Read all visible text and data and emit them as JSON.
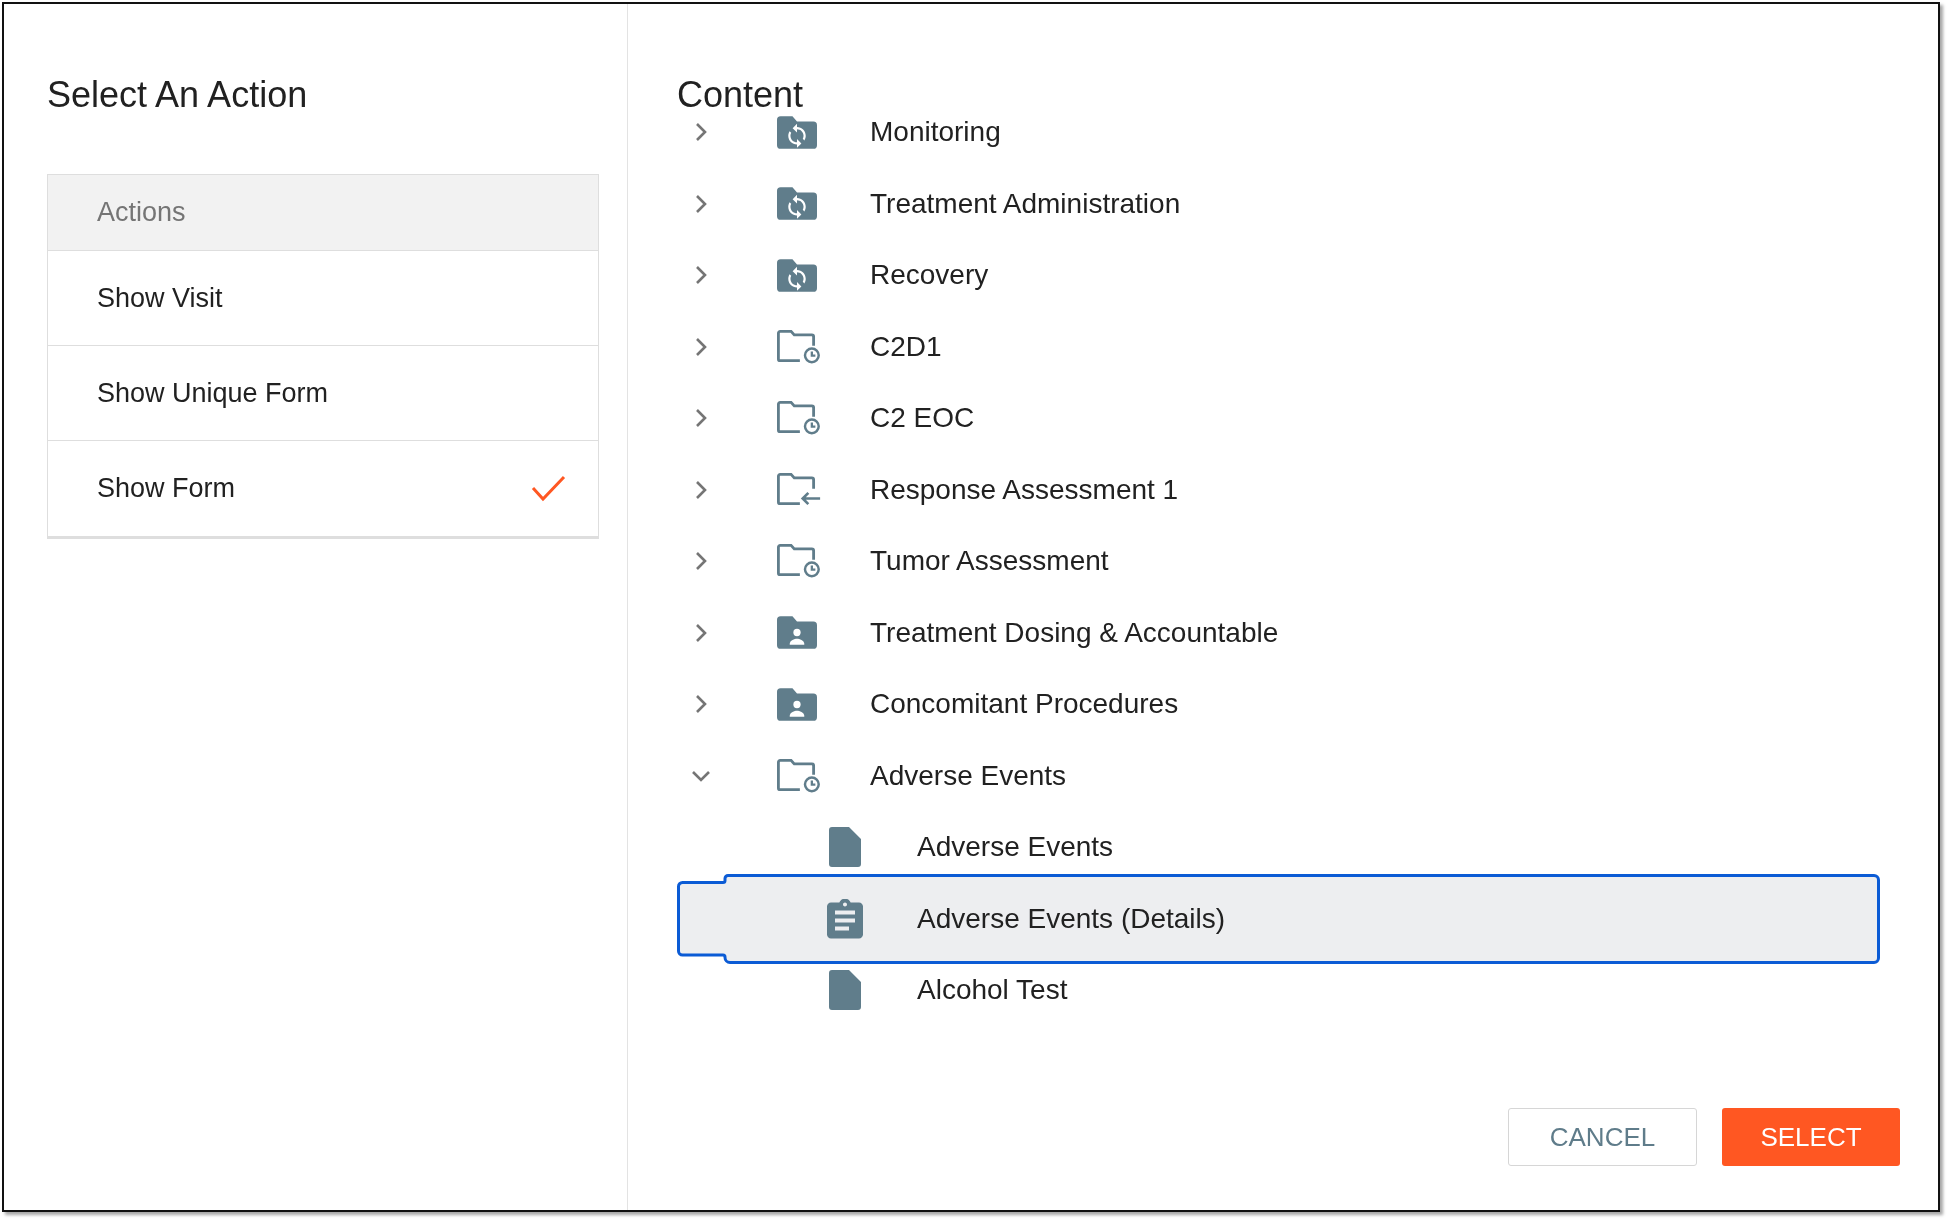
{
  "left_panel": {
    "title": "Select An Action",
    "actions": {
      "header": "Actions",
      "items": [
        {
          "label": "Show Visit",
          "selected": false
        },
        {
          "label": "Show Unique Form",
          "selected": false
        },
        {
          "label": "Show Form",
          "selected": true
        }
      ]
    }
  },
  "content_panel": {
    "title": "Content",
    "tree": [
      {
        "label": "Monitoring",
        "kind": "folder-sync",
        "expanded": false,
        "selected": false
      },
      {
        "label": "Treatment Administration",
        "kind": "folder-sync",
        "expanded": false,
        "selected": false
      },
      {
        "label": "Recovery",
        "kind": "folder-sync",
        "expanded": false,
        "selected": false
      },
      {
        "label": "C2D1",
        "kind": "folder-clock",
        "expanded": false,
        "selected": false
      },
      {
        "label": "C2 EOC",
        "kind": "folder-clock",
        "expanded": false,
        "selected": false
      },
      {
        "label": "Response Assessment 1",
        "kind": "folder-arrow",
        "expanded": false,
        "selected": false
      },
      {
        "label": "Tumor Assessment",
        "kind": "folder-clock",
        "expanded": false,
        "selected": false
      },
      {
        "label": "Treatment Dosing & Accountable",
        "kind": "folder-person",
        "expanded": false,
        "selected": false
      },
      {
        "label": "Concomitant Procedures",
        "kind": "folder-person",
        "expanded": false,
        "selected": false
      },
      {
        "label": "Adverse Events",
        "kind": "folder-clock",
        "expanded": true,
        "selected": false,
        "children": [
          {
            "label": "Adverse Events",
            "kind": "form",
            "selected": false
          },
          {
            "label": "Adverse Events (Details)",
            "kind": "form-details",
            "selected": true
          },
          {
            "label": "Alcohol Test",
            "kind": "form",
            "selected": false
          }
        ]
      }
    ]
  },
  "buttons": [
    {
      "label": "CANCEL",
      "kind": "secondary"
    },
    {
      "label": "SELECT",
      "kind": "primary"
    }
  ]
}
